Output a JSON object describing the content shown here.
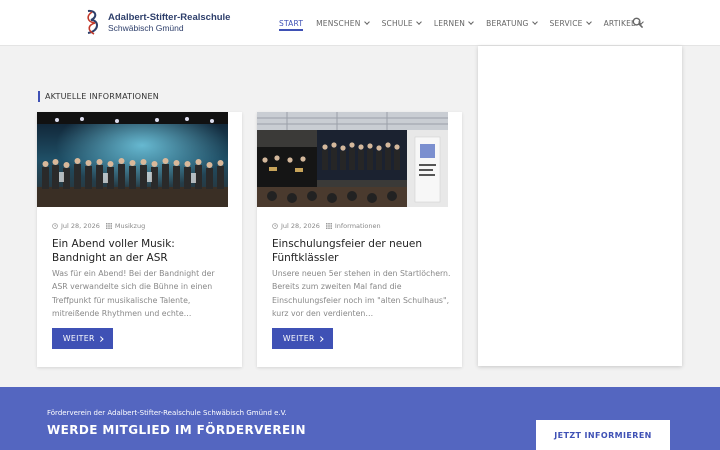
{
  "header": {
    "logo_line1": "Adalbert-Stifter-Realschule",
    "logo_line2": "Schwäbisch Gmünd",
    "search_icon": "search-icon"
  },
  "nav": [
    {
      "label": "START",
      "active": true
    },
    {
      "label": "MENSCHEN",
      "dropdown": true
    },
    {
      "label": "SCHULE",
      "dropdown": true
    },
    {
      "label": "LERNEN",
      "dropdown": true
    },
    {
      "label": "BERATUNG",
      "dropdown": true
    },
    {
      "label": "SERVICE",
      "dropdown": true
    },
    {
      "label": "ARTIKEL",
      "dropdown": true
    }
  ],
  "section": {
    "title": "AKTUELLE INFORMATIONEN"
  },
  "cards": [
    {
      "date": "Jul 28, 2026",
      "category": "Musikzug",
      "title": "Ein Abend voller Musik: Bandnight an der ASR",
      "excerpt": "Was für ein Abend! Bei der Bandnight der ASR verwandelte sich die Bühne in einen Treffpunkt für musikalische Talente, mitreißende Rhythmen und echte…",
      "button": "WEITER"
    },
    {
      "date": "Jul 28, 2026",
      "category": "Informationen",
      "title": "Einschulungsfeier der neuen Fünftklässler",
      "excerpt": "Unsere neuen 5er stehen in den Startlöchern. Bereits zum zweiten Mal fand die Einschulungsfeier noch im \"alten Schulhaus\", kurz vor den verdienten…",
      "button": "WEITER"
    }
  ],
  "band": {
    "small": "Förderverein der Adalbert-Stifter-Realschule Schwäbisch Gmünd e.V.",
    "title": "WERDE MITGLIED IM FÖRDERVEREIN",
    "button": "JETZT INFORMIEREN"
  },
  "colors": {
    "accent": "#3f51b5",
    "band": "#5466c0"
  }
}
